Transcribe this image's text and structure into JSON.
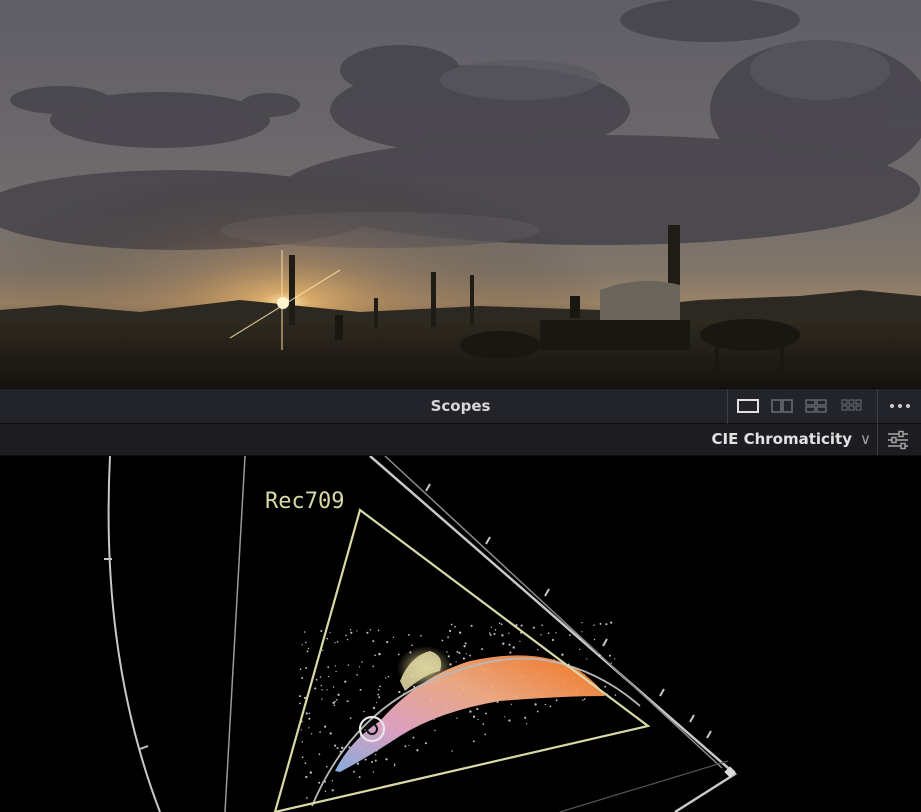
{
  "viewer": {
    "description_icon": "film-frame"
  },
  "scopes_panel": {
    "title": "Scopes",
    "layout_options": [
      "single-layout",
      "dual-layout",
      "quad-layout",
      "grid-layout"
    ],
    "selected_layout": "single-layout",
    "more_icon": "ellipsis-icon",
    "scope_type": "CIE Chromaticity",
    "settings_icon": "sliders-icon"
  },
  "chart_data": {
    "type": "scatter",
    "gamut_label": "Rec709",
    "colors": {
      "gamut": "#d8d9a6",
      "locus": "#c8c8c8",
      "white_point": "#e8e8e8"
    }
  }
}
